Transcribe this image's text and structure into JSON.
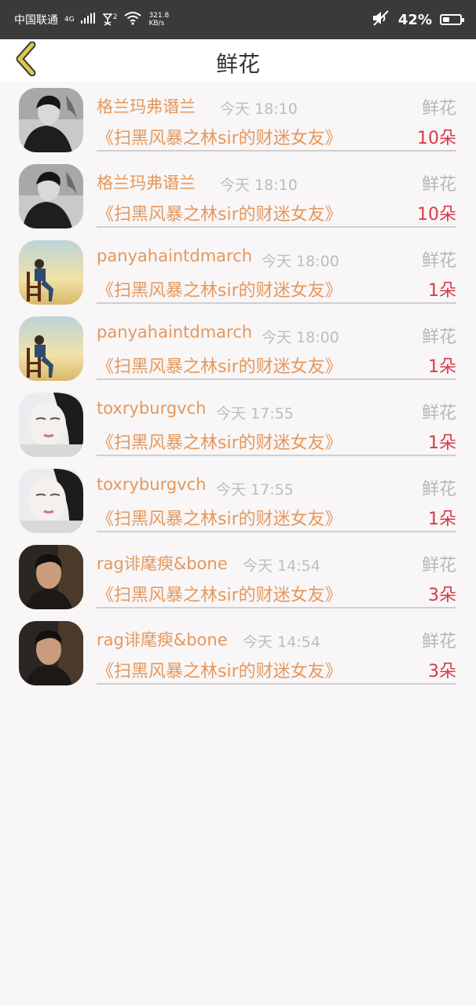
{
  "status_bar": {
    "carrier": "中国联通",
    "network": "4G",
    "sim2": "2",
    "speed_value": "321.8",
    "speed_unit": "KB/s",
    "battery_percent": "42%",
    "battery_level": 0.42
  },
  "header": {
    "title": "鲜花",
    "back_icon": "chevron-left-icon",
    "back_icon_color": "#e0c84a"
  },
  "colors": {
    "name": "#e5985c",
    "count": "#d8394a",
    "muted": "#bdbdbd"
  },
  "records": [
    {
      "name": "格兰玛弗谮兰",
      "time": "今天 18:10",
      "type": "鲜花",
      "book": "《扫黑风暴之林sir的财迷女友》",
      "count": "10朵"
    },
    {
      "name": "格兰玛弗谮兰",
      "time": "今天 18:10",
      "type": "鲜花",
      "book": "《扫黑风暴之林sir的财迷女友》",
      "count": "10朵"
    },
    {
      "name": "panyahaintdmarch",
      "time": "今天 18:00",
      "type": "鲜花",
      "book": "《扫黑风暴之林sir的财迷女友》",
      "count": "1朵"
    },
    {
      "name": "panyahaintdmarch",
      "time": "今天 18:00",
      "type": "鲜花",
      "book": "《扫黑风暴之林sir的财迷女友》",
      "count": "1朵"
    },
    {
      "name": "toxryburgvch",
      "time": "今天 17:55",
      "type": "鲜花",
      "book": "《扫黑风暴之林sir的财迷女友》",
      "count": "1朵"
    },
    {
      "name": "toxryburgvch",
      "time": "今天 17:55",
      "type": "鲜花",
      "book": "《扫黑风暴之林sir的财迷女友》",
      "count": "1朵"
    },
    {
      "name": "rag诽麾瘐&bone",
      "time": "今天 14:54",
      "type": "鲜花",
      "book": "《扫黑风暴之林sir的财迷女友》",
      "count": "3朵"
    },
    {
      "name": "rag诽麾瘐&bone",
      "time": "今天 14:54",
      "type": "鲜花",
      "book": "《扫黑风暴之林sir的财迷女友》",
      "count": "3朵"
    }
  ]
}
